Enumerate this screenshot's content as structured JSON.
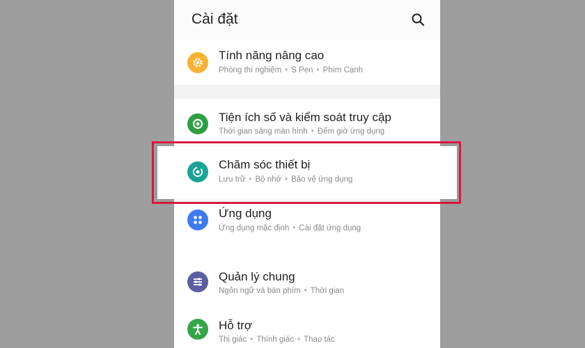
{
  "header": {
    "title": "Cài đặt",
    "search_icon": "search-icon"
  },
  "items": [
    {
      "key": "advanced",
      "title": "Tính năng nâng cao",
      "subs": [
        "Phòng thí nghiệm",
        "S Pen",
        "Phím Cạnh"
      ],
      "icon": "gear-icon",
      "color": "#f8b133"
    },
    {
      "key": "wellbeing",
      "title": "Tiện ích số và kiểm soát truy cập",
      "subs": [
        "Thời gian sáng màn hình",
        "Đếm giờ ứng dụng"
      ],
      "icon": "wellbeing-icon",
      "color": "#2ea043"
    },
    {
      "key": "device-care",
      "title": "Chăm sóc thiết bị",
      "subs": [
        "Lưu trữ",
        "Bộ nhớ",
        "Bảo vệ ứng dụng"
      ],
      "icon": "device-care-icon",
      "color": "#1aa397"
    },
    {
      "key": "apps",
      "title": "Ứng dụng",
      "subs": [
        "Ứng dụng mặc định",
        "Cài đặt ứng dụng"
      ],
      "icon": "apps-icon",
      "color": "#3e7bf0"
    },
    {
      "key": "general",
      "title": "Quản lý chung",
      "subs": [
        "Ngôn ngữ và bàn phím",
        "Thời gian"
      ],
      "icon": "sliders-icon",
      "color": "#5b5f9f"
    },
    {
      "key": "accessibility",
      "title": "Hỗ trợ",
      "subs": [
        "Thị giác",
        "Thính giác",
        "Thao tác"
      ],
      "icon": "accessibility-icon",
      "color": "#35a54a"
    }
  ],
  "highlight_color": "#d7193f"
}
